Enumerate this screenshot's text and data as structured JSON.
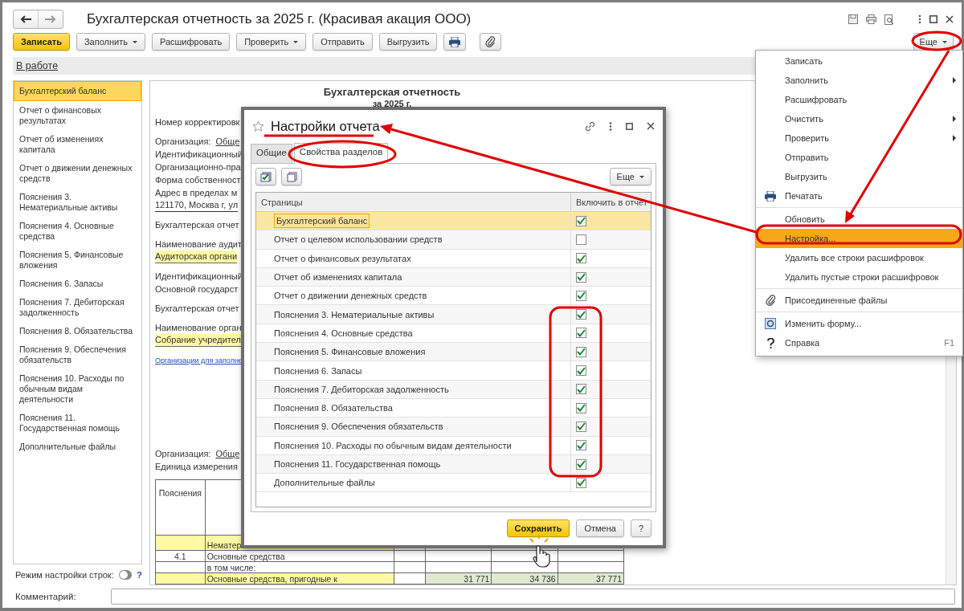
{
  "window": {
    "title": "Бухгалтерская отчетность за 2025 г. (Красивая акация ООО)"
  },
  "toolbar": {
    "buttons": [
      {
        "label": "Записать",
        "kind": "primary"
      },
      {
        "label": "Заполнить",
        "kind": "dropdown"
      },
      {
        "label": "Расшифровать",
        "kind": "plain"
      },
      {
        "label": "Проверить",
        "kind": "dropdown"
      },
      {
        "label": "Отправить",
        "kind": "plain"
      },
      {
        "label": "Выгрузить",
        "kind": "plain"
      },
      {
        "kind": "print"
      },
      {
        "kind": "attach"
      }
    ],
    "more": "Еще"
  },
  "status": "В работе",
  "sidebar": {
    "items": [
      {
        "label": "Бухгалтерский баланс",
        "selected": true
      },
      {
        "label": "Отчет о финансовых результатах",
        "selected": false
      },
      {
        "label": "Отчет об изменениях капитала",
        "selected": false
      },
      {
        "label": "Отчет о движении денежных средств",
        "selected": false
      },
      {
        "label": "Пояснения 3. Нематериальные активы",
        "selected": false
      },
      {
        "label": "Пояснения 4. Основные средства",
        "selected": false
      },
      {
        "label": "Пояснения 5. Финансовые вложения",
        "selected": false
      },
      {
        "label": "Пояснения 6. Запасы",
        "selected": false
      },
      {
        "label": "Пояснения 7. Дебиторская задолженность",
        "selected": false
      },
      {
        "label": "Пояснения 8. Обязательства",
        "selected": false
      },
      {
        "label": "Пояснения 9. Обеспечения обязательств",
        "selected": false
      },
      {
        "label": "Пояснения 10. Расходы по обычным видам деятельности",
        "selected": false
      },
      {
        "label": "Пояснения 11. Государственная помощь",
        "selected": false
      },
      {
        "label": "Дополнительные файлы",
        "selected": false
      }
    ]
  },
  "document": {
    "heading": "Бухгалтерская отчетность",
    "subheading": "за 2025 г.",
    "top_blocks": [
      [
        {
          "kind": "text",
          "text": "Номер корректировк"
        }
      ],
      [
        {
          "kind": "labeled",
          "label": "Организация:",
          "value": "Обще"
        },
        {
          "kind": "text",
          "text": "Идентификационный"
        },
        {
          "kind": "text",
          "text": "Организационно-пра"
        },
        {
          "kind": "text",
          "text": "Форма собственност"
        },
        {
          "kind": "text",
          "text": "Адрес в пределах м"
        },
        {
          "kind": "underlined",
          "text": "121170, Москва г, ул"
        }
      ],
      [
        {
          "kind": "text",
          "text": "Бухгалтерская отчет"
        }
      ],
      [
        {
          "kind": "text",
          "text": "Наименование аудит"
        },
        {
          "kind": "highlight",
          "text": "Аудиторская органи"
        }
      ],
      [
        {
          "kind": "text",
          "text": "Идентификационный"
        },
        {
          "kind": "text",
          "text": "Основной государст"
        }
      ],
      [
        {
          "kind": "text",
          "text": "Бухгалтерская отчет"
        }
      ],
      [
        {
          "kind": "text",
          "text": "Наименование орган"
        },
        {
          "kind": "highlight",
          "text": "Собрание учредител"
        }
      ],
      [
        {
          "kind": "link",
          "text": "Организации для заполне"
        }
      ]
    ],
    "bottom_lines": [
      {
        "kind": "labeled",
        "label": "Организация:",
        "value": "Обще"
      },
      {
        "kind": "text",
        "text": "Единица измерения"
      }
    ],
    "table": {
      "header": "Пояснения",
      "rows": [
        {
          "code": "",
          "name": "Нематер",
          "highlight": true,
          "values": []
        },
        {
          "code": "4.1",
          "name": "Основные средства",
          "highlight": false,
          "values": []
        },
        {
          "code": "",
          "name": "в том числе:",
          "highlight": false,
          "values": []
        },
        {
          "code": "",
          "name": "Основные средства, пригодные к",
          "highlight": true,
          "values": [
            "31 771",
            "34 736",
            "37 771"
          ]
        }
      ]
    }
  },
  "bottom": {
    "row_mode_label": "Режим настройки строк:",
    "row_mode_on": false,
    "help": "?",
    "comment_label": "Комментарий:"
  },
  "dialog": {
    "title": "Настройки отчета",
    "tabs": [
      {
        "label": "Общие",
        "selected": false
      },
      {
        "label": "Свойства разделов",
        "selected": true
      }
    ],
    "more": "Еще",
    "columns": [
      "Страницы",
      "Включить в отчет"
    ],
    "rows": [
      {
        "name": "Бухгалтерский баланс",
        "checked": true,
        "selected": true
      },
      {
        "name": "Отчет о целевом использовании средств",
        "checked": false,
        "selected": false
      },
      {
        "name": "Отчет о финансовых результатах",
        "checked": true,
        "selected": false
      },
      {
        "name": "Отчет об изменениях капитала",
        "checked": true,
        "selected": false
      },
      {
        "name": "Отчет о движении денежных средств",
        "checked": true,
        "selected": false
      },
      {
        "name": "Пояснения 3. Нематериальные активы",
        "checked": true,
        "selected": false
      },
      {
        "name": "Пояснения 4. Основные средства",
        "checked": true,
        "selected": false
      },
      {
        "name": "Пояснения 5. Финансовые вложения",
        "checked": true,
        "selected": false
      },
      {
        "name": "Пояснения 6. Запасы",
        "checked": true,
        "selected": false
      },
      {
        "name": "Пояснения 7. Дебиторская задолженность",
        "checked": true,
        "selected": false
      },
      {
        "name": "Пояснения 8. Обязательства",
        "checked": true,
        "selected": false
      },
      {
        "name": "Пояснения 9. Обеспечения обязательств",
        "checked": true,
        "selected": false
      },
      {
        "name": "Пояснения 10. Расходы по обычным видам деятельности",
        "checked": true,
        "selected": false
      },
      {
        "name": "Пояснения 11. Государственная помощь",
        "checked": true,
        "selected": false
      },
      {
        "name": "Дополнительные файлы",
        "checked": true,
        "selected": false
      }
    ],
    "buttons": [
      {
        "label": "Сохранить",
        "kind": "primary"
      },
      {
        "label": "Отмена",
        "kind": "plain"
      },
      {
        "label": "?",
        "kind": "plain"
      }
    ]
  },
  "menu": {
    "items": [
      {
        "kind": "plain",
        "label": "Записать",
        "submenu": false,
        "selected": false
      },
      {
        "kind": "plain",
        "label": "Заполнить",
        "submenu": true,
        "selected": false
      },
      {
        "kind": "plain",
        "label": "Расшифровать",
        "submenu": false,
        "selected": false
      },
      {
        "kind": "plain",
        "label": "Очистить",
        "submenu": true,
        "selected": false
      },
      {
        "kind": "plain",
        "label": "Проверить",
        "submenu": true,
        "selected": false
      },
      {
        "kind": "plain",
        "label": "Отправить",
        "submenu": false,
        "selected": false
      },
      {
        "kind": "plain",
        "label": "Выгрузить",
        "submenu": false,
        "selected": false
      },
      {
        "kind": "print",
        "label": "Печатать",
        "submenu": false,
        "selected": false
      },
      {
        "kind": "separator"
      },
      {
        "kind": "plain",
        "label": "Обновить",
        "submenu": false,
        "selected": false
      },
      {
        "kind": "plain",
        "label": "Настройка...",
        "submenu": false,
        "selected": true
      },
      {
        "kind": "plain",
        "label": "Удалить все строки расшифровок",
        "submenu": false,
        "selected": false
      },
      {
        "kind": "plain",
        "label": "Удалить пустые строки расшифровок",
        "submenu": false,
        "selected": false
      },
      {
        "kind": "separator"
      },
      {
        "kind": "attach",
        "label": "Присоединенные файлы",
        "submenu": false,
        "selected": false
      },
      {
        "kind": "separator"
      },
      {
        "kind": "form",
        "label": "Изменить форму...",
        "submenu": false,
        "selected": false
      },
      {
        "kind": "help",
        "label": "Справка",
        "submenu": false,
        "selected": false,
        "shortcut": "F1"
      }
    ]
  }
}
